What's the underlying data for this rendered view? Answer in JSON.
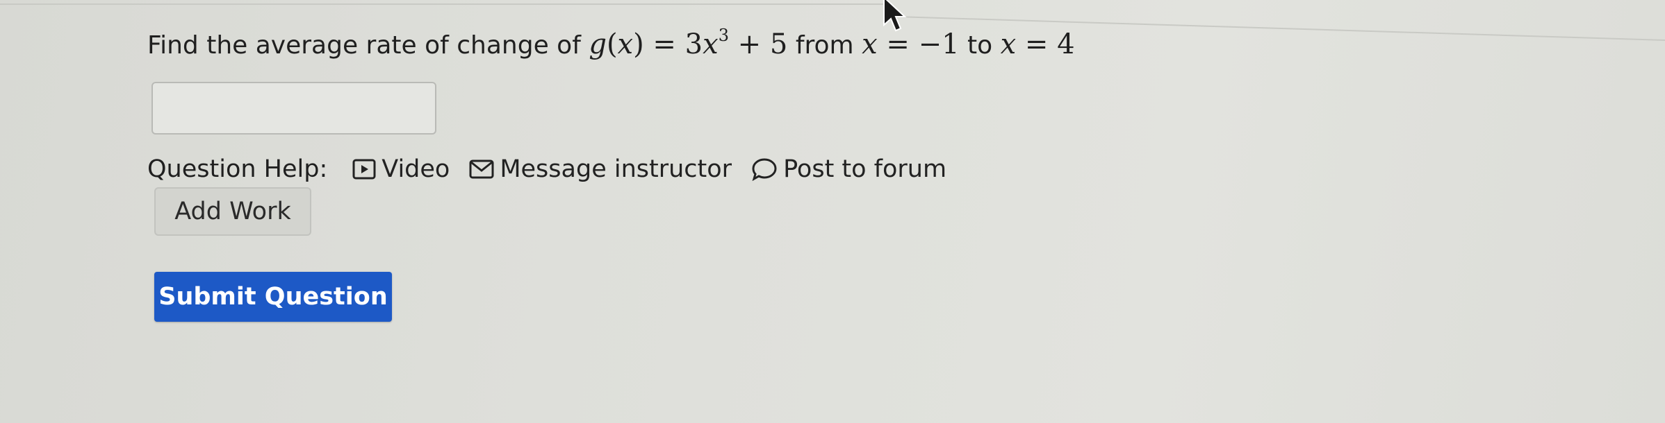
{
  "question": {
    "prefix": "Find the average rate of change of ",
    "function_name": "g",
    "variable": "x",
    "coefficient": "3",
    "exponent": "3",
    "constant": "5",
    "from_label": "from",
    "x_start": "−1",
    "to_label": "to",
    "x_end": "4"
  },
  "answer": {
    "value": ""
  },
  "help": {
    "label": "Question Help:",
    "video": "Video",
    "message": "Message instructor",
    "forum": "Post to forum"
  },
  "buttons": {
    "add_work": "Add Work",
    "submit": "Submit Question"
  },
  "colors": {
    "submit_bg": "#1d59c6",
    "background": "#dedfda"
  }
}
